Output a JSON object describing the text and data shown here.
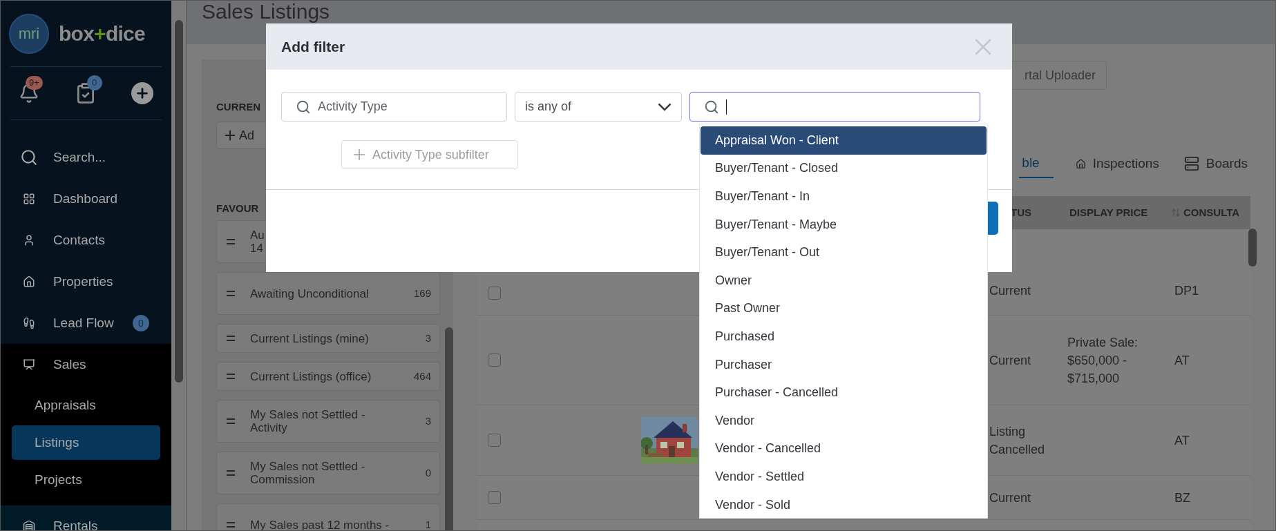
{
  "sidebar": {
    "logo": "mri",
    "brand": {
      "left": "box",
      "joiner": "+",
      "right": "dice"
    },
    "quick_actions": {
      "notifications_badge": "9+",
      "tasks_badge": "0"
    },
    "nav": [
      {
        "label": "Search...",
        "selected": false
      },
      {
        "label": "Dashboard",
        "selected": false
      },
      {
        "label": "Contacts",
        "selected": false
      },
      {
        "label": "Properties",
        "selected": false
      },
      {
        "label": "Lead Flow",
        "selected": false,
        "badge": "0"
      },
      {
        "label": "Sales",
        "selected": false,
        "expanded": true,
        "children": [
          {
            "label": "Appraisals",
            "selected": false
          },
          {
            "label": "Listings",
            "selected": true
          },
          {
            "label": "Projects",
            "selected": false
          }
        ]
      },
      {
        "label": "Rentals",
        "selected": false
      }
    ]
  },
  "page": {
    "title": "Sales Listings",
    "filters_panel": {
      "current_label": "CURREN",
      "add_button": "Ad",
      "favourites_label": "FAVOUR",
      "favourites": [
        {
          "label": "Au\n14"
        },
        {
          "label": "Awaiting Unconditional",
          "count": "169"
        },
        {
          "label": "Current Listings (mine)",
          "count": "3"
        },
        {
          "label": "Current Listings (office)",
          "count": "464"
        },
        {
          "label": "My Sales not Settled - Activity",
          "count": "3"
        },
        {
          "label": "My Sales not Settled - Commission",
          "count": "0"
        },
        {
          "label": "My Sales past 12 months -",
          "count": "1"
        }
      ]
    },
    "toolbar_button": "rtal Uploader",
    "tabs": [
      {
        "label": "ble",
        "selected": true
      },
      {
        "label": "Inspections",
        "selected": false
      },
      {
        "label": "Boards",
        "selected": false
      }
    ],
    "table": {
      "columns": [
        "TUS",
        "DISPLAY PRICE",
        "CONSULTA"
      ],
      "rows": [
        {
          "checked": false,
          "picture": false,
          "status": "Current",
          "price": "",
          "consultant": "DP1"
        },
        {
          "checked": false,
          "picture": false,
          "status": "Current",
          "price": "Private Sale: $650,000 - $715,000",
          "consultant": "AT"
        },
        {
          "checked": false,
          "picture": true,
          "status": "Listing Cancelled",
          "price": "",
          "consultant": "AT"
        },
        {
          "checked": false,
          "picture": false,
          "status": "Current",
          "price": "",
          "consultant": "BZ"
        }
      ]
    }
  },
  "dialog": {
    "title": "Add filter",
    "field": "Activity Type",
    "operator": "is any of",
    "subfilter_button": "Activity Type subfilter",
    "options": [
      {
        "label": "Appraisal Won - Client",
        "selected": true
      },
      {
        "label": "Buyer/Tenant - Closed",
        "selected": false
      },
      {
        "label": "Buyer/Tenant - In",
        "selected": false
      },
      {
        "label": "Buyer/Tenant - Maybe",
        "selected": false
      },
      {
        "label": "Buyer/Tenant - Out",
        "selected": false
      },
      {
        "label": "Owner",
        "selected": false
      },
      {
        "label": "Past Owner",
        "selected": false
      },
      {
        "label": "Purchased",
        "selected": false
      },
      {
        "label": "Purchaser",
        "selected": false
      },
      {
        "label": "Purchaser - Cancelled",
        "selected": false
      },
      {
        "label": "Vendor",
        "selected": false
      },
      {
        "label": "Vendor - Cancelled",
        "selected": false
      },
      {
        "label": "Vendor - Settled",
        "selected": false
      },
      {
        "label": "Vendor - Sold",
        "selected": false
      }
    ]
  }
}
